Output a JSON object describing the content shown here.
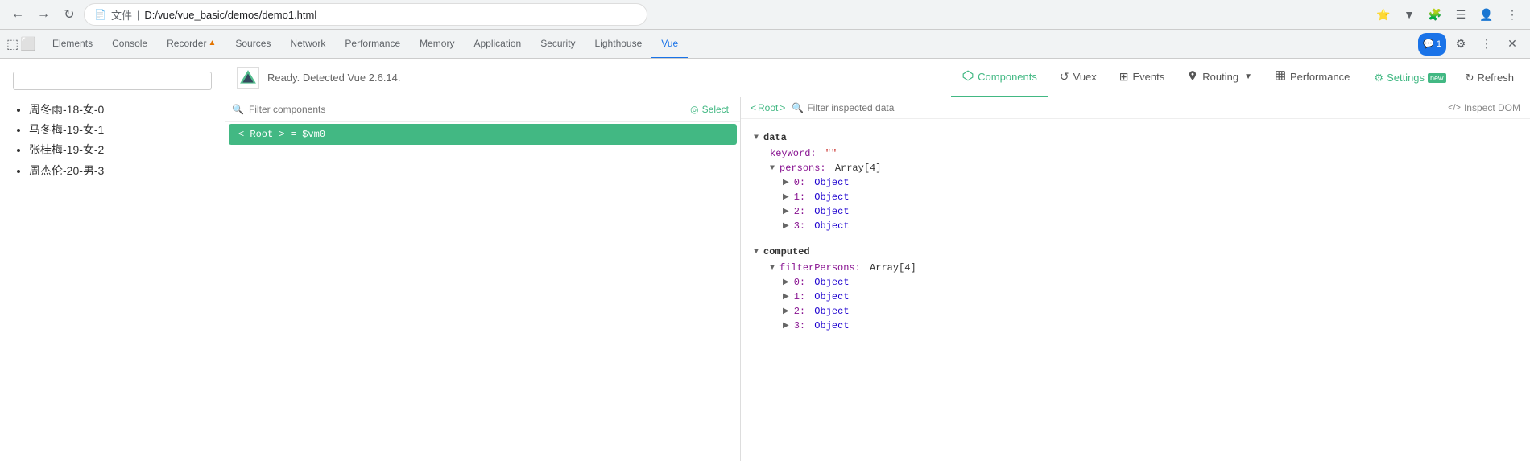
{
  "browser": {
    "back_btn": "←",
    "forward_btn": "→",
    "reload_btn": "↻",
    "url_icon": "📄",
    "url_label": "文件",
    "url_path": "D:/vue/vue_basic/demos/demo1.html",
    "chrome_actions": [
      "⭐",
      "▼",
      "🧩",
      "☰",
      "👤",
      "⋮"
    ]
  },
  "devtools_tabs": {
    "items": [
      {
        "label": "Elements",
        "active": false
      },
      {
        "label": "Console",
        "active": false
      },
      {
        "label": "Recorder",
        "active": false
      },
      {
        "label": "Sources",
        "active": false
      },
      {
        "label": "Network",
        "active": false
      },
      {
        "label": "Performance",
        "active": false
      },
      {
        "label": "Memory",
        "active": false
      },
      {
        "label": "Application",
        "active": false
      },
      {
        "label": "Security",
        "active": false
      },
      {
        "label": "Lighthouse",
        "active": false
      },
      {
        "label": "Vue",
        "active": true
      }
    ],
    "action_icons": [
      "💬 1",
      "⚙",
      "⋮",
      "✕"
    ]
  },
  "page": {
    "search_placeholder": "",
    "list_items": [
      "周冬雨-18-女-0",
      "马冬梅-19-女-1",
      "张桂梅-19-女-2",
      "周杰伦-20-男-3"
    ]
  },
  "vue_toolbar": {
    "logo_text": "Vue",
    "ready_text": "Ready. Detected Vue 2.6.14.",
    "nav_items": [
      {
        "label": "Components",
        "icon": "⬡",
        "active": true
      },
      {
        "label": "Vuex",
        "icon": "↺",
        "active": false
      },
      {
        "label": "Events",
        "icon": "⊞",
        "active": false
      },
      {
        "label": "Routing",
        "icon": "◆",
        "has_dropdown": true,
        "active": false
      },
      {
        "label": "Performance",
        "icon": "📊",
        "active": false
      }
    ],
    "settings_label": "Settings",
    "settings_badge": "new",
    "refresh_label": "Refresh"
  },
  "components_panel": {
    "filter_placeholder": "Filter components",
    "select_label": "Select",
    "tree_items": [
      {
        "label": "< Root > = $vm0",
        "selected": true
      }
    ]
  },
  "inspector": {
    "breadcrumb_open": "<",
    "breadcrumb_label": "Root",
    "breadcrumb_close": ">",
    "filter_placeholder": "Filter inspected data",
    "inspect_dom_label": "Inspect DOM",
    "data": {
      "section_label": "data",
      "props": [
        {
          "key": "keyWord:",
          "value": "\"\"",
          "type": "string"
        },
        {
          "key": "persons:",
          "value": "Array[4]",
          "type": "array",
          "expandable": true,
          "children": [
            {
              "key": "0:",
              "value": "Object",
              "expandable": true
            },
            {
              "key": "1:",
              "value": "Object",
              "expandable": true
            },
            {
              "key": "2:",
              "value": "Object",
              "expandable": true
            },
            {
              "key": "3:",
              "value": "Object",
              "expandable": true
            }
          ]
        }
      ]
    },
    "computed": {
      "section_label": "computed",
      "props": [
        {
          "key": "filterPersons:",
          "value": "Array[4]",
          "type": "array",
          "expandable": true,
          "children": [
            {
              "key": "0:",
              "value": "Object",
              "expandable": true
            },
            {
              "key": "1:",
              "value": "Object",
              "expandable": true
            },
            {
              "key": "2:",
              "value": "Object",
              "expandable": true
            },
            {
              "key": "3:",
              "value": "Object",
              "expandable": true
            }
          ]
        }
      ]
    }
  }
}
